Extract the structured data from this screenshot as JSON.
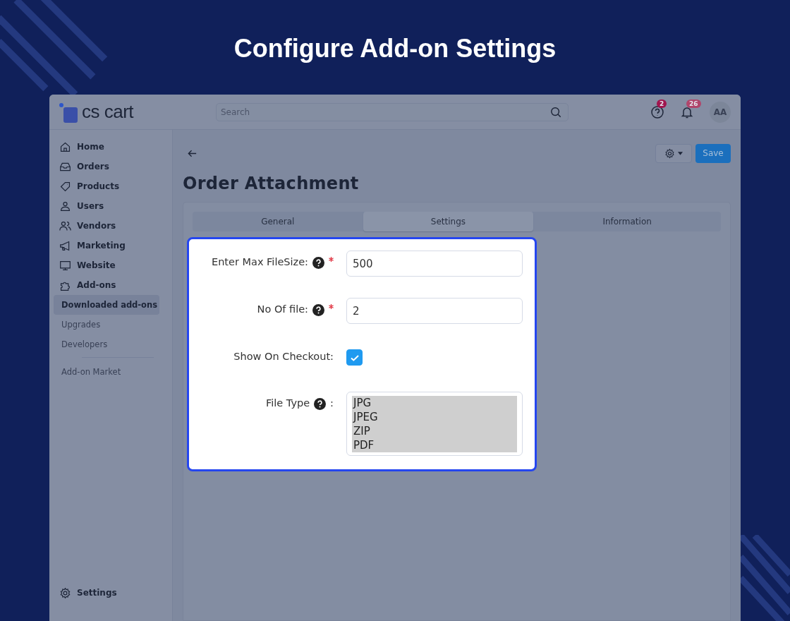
{
  "page_title": "Configure Add-on Settings",
  "topbar": {
    "logo": "cs cart",
    "search": {
      "placeholder": "Search"
    },
    "help_badge": "2",
    "notifications_badge": "26",
    "avatar": "AA"
  },
  "sidebar": {
    "items": [
      {
        "label": "Home"
      },
      {
        "label": "Orders"
      },
      {
        "label": "Products"
      },
      {
        "label": "Users"
      },
      {
        "label": "Vendors"
      },
      {
        "label": "Marketing"
      },
      {
        "label": "Website"
      },
      {
        "label": "Add-ons"
      }
    ],
    "subitems": [
      {
        "label": "Downloaded add-ons",
        "selected": true
      },
      {
        "label": "Upgrades",
        "selected": false
      },
      {
        "label": "Developers",
        "selected": false
      }
    ],
    "extra": [
      "Add-on Market"
    ],
    "footer": "Settings"
  },
  "header": {
    "title": "Order Attachment",
    "save": "Save"
  },
  "tabs": [
    {
      "label": "General",
      "selected": false
    },
    {
      "label": "Settings",
      "selected": true
    },
    {
      "label": "Information",
      "selected": false
    }
  ],
  "form": {
    "fields": [
      {
        "kind": "text",
        "label": "Enter Max FileSize:",
        "help": true,
        "required": true,
        "value": "500"
      },
      {
        "kind": "text",
        "label": "No Of file:",
        "help": true,
        "required": true,
        "value": "2"
      },
      {
        "kind": "checkbox",
        "label": "Show On Checkout:",
        "help": false,
        "required": false,
        "checked": true
      },
      {
        "kind": "list",
        "label": "File Type",
        "help": true,
        "required": false,
        "colon": ":",
        "options": [
          {
            "label": "JPG",
            "selected": true
          },
          {
            "label": "JPEG",
            "selected": true
          },
          {
            "label": "ZIP",
            "selected": true
          },
          {
            "label": "PDF",
            "selected": true
          }
        ]
      }
    ]
  }
}
